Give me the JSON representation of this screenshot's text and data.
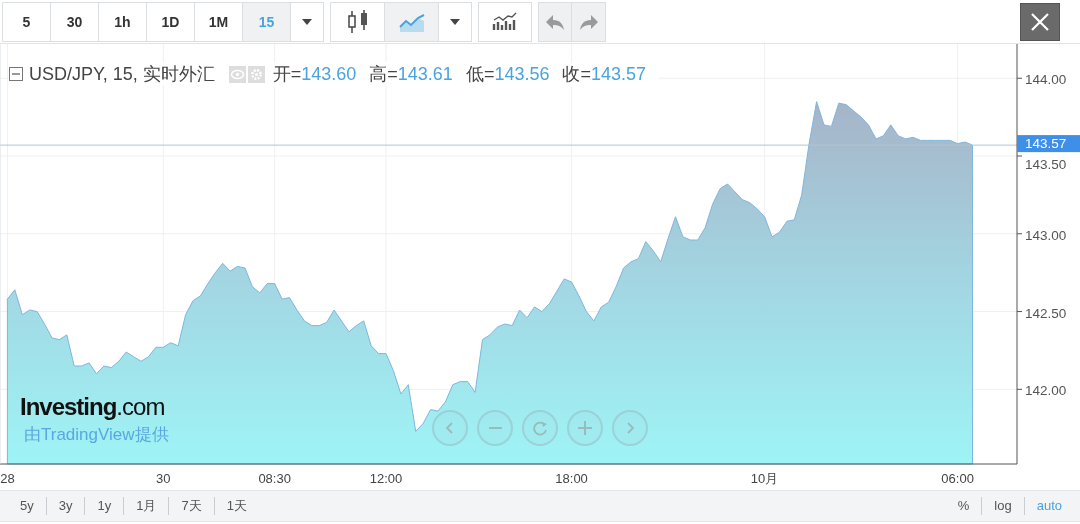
{
  "toolbar": {
    "intervals": [
      {
        "label": "5",
        "selected": false
      },
      {
        "label": "30",
        "selected": false
      },
      {
        "label": "1h",
        "selected": false
      },
      {
        "label": "1D",
        "selected": false
      },
      {
        "label": "1M",
        "selected": false
      },
      {
        "label": "15",
        "selected": true
      }
    ],
    "chart_types": [
      {
        "kind": "candles",
        "selected": false
      },
      {
        "kind": "area",
        "selected": true
      }
    ],
    "history": [
      {
        "kind": "undo",
        "disabled": true
      },
      {
        "kind": "redo",
        "disabled": true
      }
    ]
  },
  "legend": {
    "symbol": "USD/JPY, 15, 实时外汇",
    "ohlc": [
      {
        "label": "开=",
        "value": "143.60"
      },
      {
        "label": "高=",
        "value": "143.61"
      },
      {
        "label": "低=",
        "value": "143.56"
      },
      {
        "label": "收=",
        "value": "143.57"
      }
    ]
  },
  "chart": {
    "chart_data": {
      "type": "area",
      "grid": true,
      "ylim": [
        141.52,
        144.22
      ],
      "ref_lines": [
        {
          "axis": "y",
          "value": 143.57,
          "label": "143.57"
        }
      ],
      "categories": [
        "28",
        null,
        null,
        null,
        null,
        null,
        null,
        null,
        null,
        null,
        null,
        null,
        null,
        null,
        null,
        null,
        null,
        null,
        null,
        null,
        null,
        "30",
        null,
        null,
        null,
        null,
        null,
        null,
        null,
        null,
        null,
        null,
        null,
        null,
        null,
        null,
        "08:30",
        null,
        null,
        null,
        null,
        null,
        null,
        null,
        null,
        null,
        null,
        null,
        null,
        null,
        null,
        "12:00",
        null,
        null,
        null,
        null,
        null,
        null,
        null,
        null,
        null,
        null,
        null,
        null,
        null,
        null,
        null,
        null,
        null,
        null,
        null,
        null,
        null,
        null,
        null,
        null,
        "18:00",
        null,
        null,
        null,
        null,
        null,
        null,
        null,
        null,
        null,
        null,
        null,
        null,
        null,
        null,
        null,
        null,
        null,
        null,
        null,
        null,
        null,
        null,
        null,
        null,
        null,
        "10月",
        null,
        null,
        null,
        null,
        null,
        null,
        null,
        null,
        null,
        null,
        null,
        null,
        null,
        null,
        null,
        null,
        null,
        null,
        null,
        null,
        null,
        null,
        null,
        null,
        null,
        "06:00",
        null,
        null
      ],
      "yticks": [
        {
          "value": 142,
          "label": "142.00"
        },
        {
          "value": 142.5,
          "label": "142.50"
        },
        {
          "value": 143,
          "label": "143.00"
        },
        {
          "value": 143.5,
          "label": "143.50"
        },
        {
          "value": 144,
          "label": "144.00"
        }
      ],
      "series": [
        {
          "color": "#7fb6de",
          "values": [
            142.58,
            142.64,
            142.48,
            142.51,
            142.5,
            142.42,
            142.33,
            142.32,
            142.35,
            142.15,
            142.15,
            142.17,
            142.1,
            142.15,
            142.14,
            142.18,
            142.24,
            142.21,
            142.18,
            142.21,
            142.27,
            142.27,
            142.3,
            142.28,
            142.48,
            142.57,
            142.6,
            142.68,
            142.75,
            142.81,
            142.76,
            142.79,
            142.78,
            142.66,
            142.62,
            142.68,
            142.68,
            142.58,
            142.59,
            142.51,
            142.44,
            142.41,
            142.41,
            142.43,
            142.51,
            142.44,
            142.37,
            142.41,
            142.44,
            142.28,
            142.23,
            142.23,
            142.12,
            141.97,
            142.03,
            141.73,
            141.78,
            141.87,
            141.86,
            141.92,
            142.03,
            142.05,
            142.05,
            141.98,
            142.32,
            142.35,
            142.4,
            142.42,
            142.41,
            142.51,
            142.46,
            142.53,
            142.5,
            142.55,
            142.63,
            142.71,
            142.69,
            142.6,
            142.5,
            142.44,
            142.53,
            142.56,
            142.66,
            142.78,
            142.82,
            142.84,
            142.95,
            142.89,
            142.82,
            142.97,
            143.11,
            142.98,
            142.96,
            142.96,
            143.04,
            143.19,
            143.29,
            143.32,
            143.27,
            143.22,
            143.2,
            143.16,
            143.11,
            142.98,
            143.01,
            143.08,
            143.09,
            143.25,
            143.58,
            143.85,
            143.7,
            143.69,
            143.84,
            143.83,
            143.79,
            143.75,
            143.7,
            143.61,
            143.63,
            143.7,
            143.63,
            143.61,
            143.62,
            143.6,
            143.6,
            143.6,
            143.6,
            143.6,
            143.58,
            143.59,
            143.57
          ]
        }
      ]
    }
  },
  "branding": {
    "logo": "**Investing**.com",
    "credit": "由TradingView提供"
  },
  "nav_buttons": [
    {
      "kind": "left"
    },
    {
      "kind": "minus"
    },
    {
      "kind": "reset"
    },
    {
      "kind": "plus"
    },
    {
      "kind": "right"
    }
  ],
  "ranges": [
    {
      "label": "5y"
    },
    {
      "label": "3y"
    },
    {
      "label": "1y"
    },
    {
      "label": "1月"
    },
    {
      "label": "7天"
    },
    {
      "label": "1天"
    }
  ],
  "scale_options": [
    {
      "label": "%",
      "selected": false
    },
    {
      "label": "log",
      "selected": false
    },
    {
      "label": "auto",
      "selected": true
    }
  ]
}
